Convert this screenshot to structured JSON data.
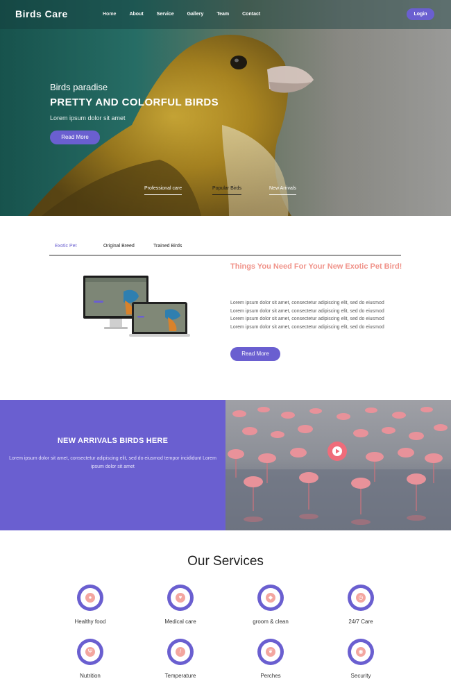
{
  "brand": "Birds Care",
  "nav": {
    "links": [
      "Home",
      "About",
      "Service",
      "Gallery",
      "Team",
      "Contact"
    ],
    "login": "Login"
  },
  "hero": {
    "subtitle": "Birds paradise",
    "title": "PRETTY AND COLORFUL BIRDS",
    "description": "Lorem ipsum dolor sit amet",
    "button": "Read More",
    "tabs": [
      "Professional care",
      "Popular Birds",
      "New Arrivals"
    ]
  },
  "features": {
    "tabs": [
      "Exotic Pet",
      "Original Breed",
      "Trained Birds"
    ],
    "title": "Things You Need For Your New Exotic Pet Bird!",
    "text": "Lorem ipsum dolor sit amet, consectetur adipiscing elit, sed do eiusmod Lorem ipsum dolor sit amet, consectetur adipiscing elit, sed do eiusmod Lorem ipsum dolor sit amet, consectetur adipiscing elit, sed do eiusmod Lorem ipsum dolor sit amet, consectetur adipiscing elit, sed do eiusmod",
    "button": "Read More"
  },
  "arrivals": {
    "title": "NEW ARRIVALS BIRDS HERE",
    "text": "Lorem ipsum dolor sit amet, consectetur adipiscing elit, sed do eiusmod tempor incididunt Lorem ipsum dolor sit amet"
  },
  "services": {
    "title": "Our Services",
    "items": [
      {
        "label": "Healthy food",
        "icon": "apple-icon"
      },
      {
        "label": "Medical care",
        "icon": "heartbeat-icon"
      },
      {
        "label": "groom & clean",
        "icon": "diamond-icon"
      },
      {
        "label": "24/7 Care",
        "icon": "clock-icon"
      },
      {
        "label": "Nutrition",
        "icon": "cutlery-icon"
      },
      {
        "label": "Temperature",
        "icon": "thermometer-icon"
      },
      {
        "label": "Perches",
        "icon": "leaf-icon"
      },
      {
        "label": "Security",
        "icon": "eye-icon"
      }
    ]
  },
  "colors": {
    "accent": "#6a5fd0",
    "heading_pink": "#f0938a"
  }
}
